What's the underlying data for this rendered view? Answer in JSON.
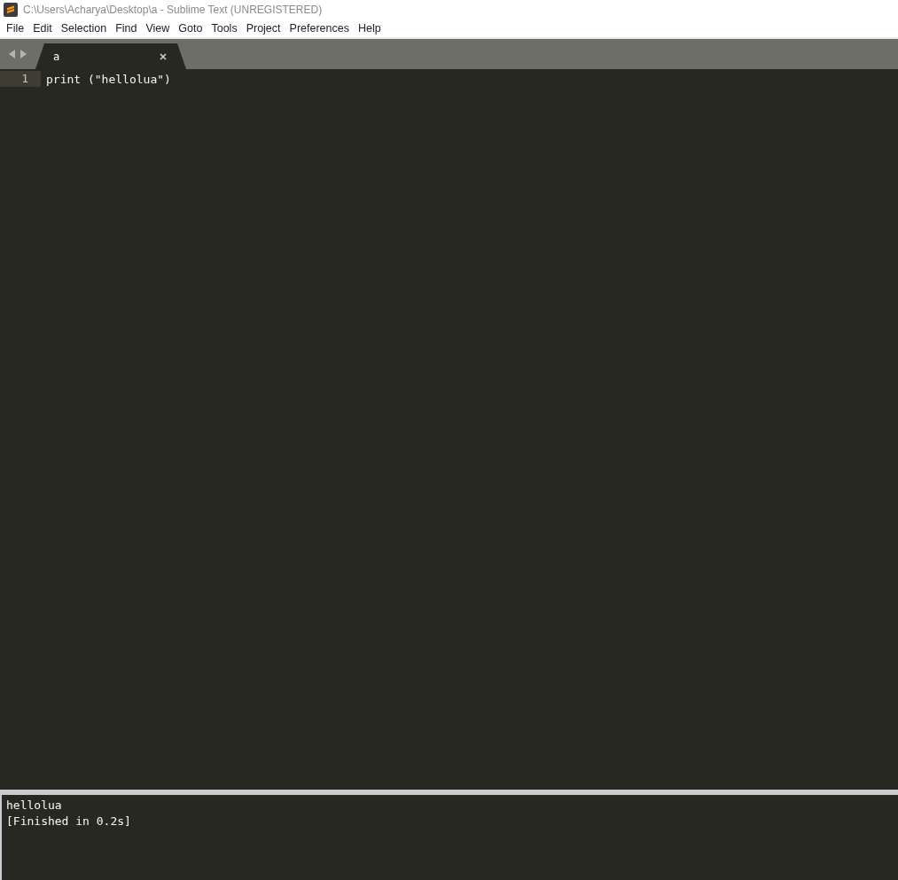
{
  "window": {
    "title": "C:\\Users\\Acharya\\Desktop\\a - Sublime Text (UNREGISTERED)"
  },
  "menu": [
    "File",
    "Edit",
    "Selection",
    "Find",
    "View",
    "Goto",
    "Tools",
    "Project",
    "Preferences",
    "Help"
  ],
  "tabs": [
    {
      "label": "a",
      "selected": true
    }
  ],
  "editor": {
    "lines": [
      {
        "number": "1",
        "text": "print (\"hellolua\")",
        "current": true
      }
    ]
  },
  "output": {
    "lines": [
      "hellolua",
      "[Finished in 0.2s]"
    ]
  }
}
